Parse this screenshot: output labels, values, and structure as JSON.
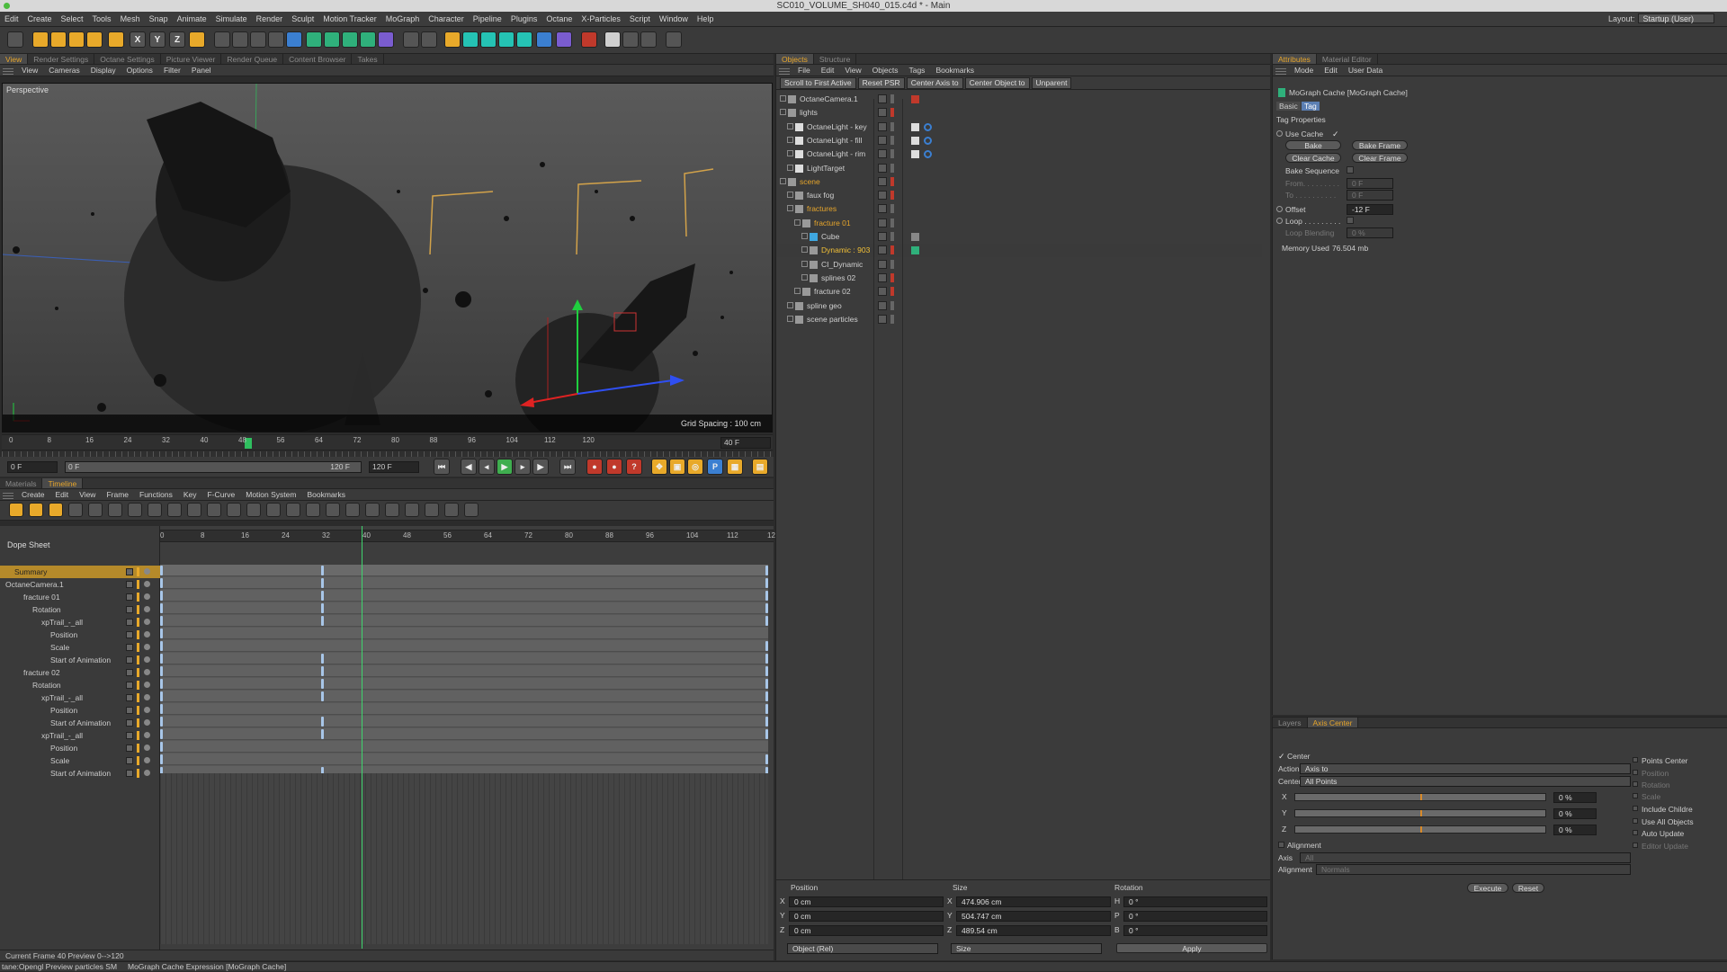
{
  "window": {
    "title": "SC010_VOLUME_SH040_015.c4d * - Main"
  },
  "menubar": [
    "Edit",
    "Create",
    "Select",
    "Tools",
    "Mesh",
    "Snap",
    "Animate",
    "Simulate",
    "Render",
    "Sculpt",
    "Motion Tracker",
    "MoGraph",
    "Character",
    "Pipeline",
    "Plugins",
    "Octane",
    "X-Particles",
    "Script",
    "Window",
    "Help"
  ],
  "layout": {
    "label": "Layout:",
    "value": "Startup (User)"
  },
  "viewport_tabs": [
    "View",
    "Render Settings",
    "Octane Settings",
    "Picture Viewer",
    "Render Queue",
    "Content Browser",
    "Takes"
  ],
  "viewport_menu": [
    "View",
    "Cameras",
    "Display",
    "Options",
    "Filter",
    "Panel"
  ],
  "viewport": {
    "label": "Perspective",
    "grid_spacing": "Grid Spacing : 100 cm"
  },
  "timeline_ruler": {
    "ticks": [
      "0",
      "8",
      "16",
      "24",
      "32",
      "40",
      "48",
      "56",
      "64",
      "72",
      "80",
      "88",
      "96",
      "104",
      "112",
      "120"
    ],
    "current": "40 F"
  },
  "playback": {
    "start": "0 F",
    "range_end": "120 F",
    "end": "120 F",
    "slider_start": "0 F"
  },
  "bottom_tabs": [
    "Materials",
    "Timeline"
  ],
  "timeline_menu": [
    "Create",
    "Edit",
    "View",
    "Frame",
    "Functions",
    "Key",
    "F-Curve",
    "Motion System",
    "Bookmarks"
  ],
  "dopesheet": {
    "title": "Dope Sheet",
    "ticks": [
      "0",
      "8",
      "16",
      "24",
      "32",
      "40",
      "48",
      "56",
      "64",
      "72",
      "80",
      "88",
      "96",
      "104",
      "112",
      "120"
    ],
    "rows": [
      {
        "label": "Summary",
        "indent": 1
      },
      {
        "label": "OctaneCamera.1",
        "indent": 0
      },
      {
        "label": "fracture 01",
        "indent": 2
      },
      {
        "label": "Rotation",
        "indent": 3
      },
      {
        "label": "xpTrail_-_all",
        "indent": 4
      },
      {
        "label": "Position",
        "indent": 5
      },
      {
        "label": "Scale",
        "indent": 5
      },
      {
        "label": "Start of Animation",
        "indent": 5
      },
      {
        "label": "fracture 02",
        "indent": 2
      },
      {
        "label": "Rotation",
        "indent": 3
      },
      {
        "label": "xpTrail_-_all",
        "indent": 4
      },
      {
        "label": "Position",
        "indent": 5
      },
      {
        "label": "Start of Animation",
        "indent": 5
      },
      {
        "label": "xpTrail_-_all",
        "indent": 4
      },
      {
        "label": "Position",
        "indent": 5
      },
      {
        "label": "Scale",
        "indent": 5
      },
      {
        "label": "Start of Animation",
        "indent": 5
      }
    ],
    "status": "Current Frame  40  Preview  0-->120"
  },
  "objects_tabs": [
    "Objects",
    "Structure"
  ],
  "objects_menu": [
    "File",
    "Edit",
    "View",
    "Objects",
    "Tags",
    "Bookmarks"
  ],
  "objects_buttons": [
    "Scroll to First Active",
    "Reset PSR",
    "Center Axis to",
    "Center Object to",
    "Unparent"
  ],
  "objects": [
    {
      "name": "OctaneCamera.1",
      "indent": 0,
      "color": "normal"
    },
    {
      "name": "lights",
      "indent": 0,
      "color": "normal"
    },
    {
      "name": "OctaneLight - key",
      "indent": 1,
      "color": "normal"
    },
    {
      "name": "OctaneLight - fill",
      "indent": 1,
      "color": "normal"
    },
    {
      "name": "OctaneLight - rim",
      "indent": 1,
      "color": "normal"
    },
    {
      "name": "LightTarget",
      "indent": 1,
      "color": "normal"
    },
    {
      "name": "scene",
      "indent": 0,
      "color": "orange"
    },
    {
      "name": "faux fog",
      "indent": 1,
      "color": "normal"
    },
    {
      "name": "fractures",
      "indent": 1,
      "color": "orange"
    },
    {
      "name": "fracture 01",
      "indent": 2,
      "color": "orange"
    },
    {
      "name": "Cube",
      "indent": 3,
      "color": "normal"
    },
    {
      "name": "Dynamic : 903",
      "indent": 3,
      "color": "selected"
    },
    {
      "name": "CI_Dynamic",
      "indent": 3,
      "color": "normal"
    },
    {
      "name": "splines 02",
      "indent": 3,
      "color": "normal"
    },
    {
      "name": "fracture 02",
      "indent": 2,
      "color": "normal"
    },
    {
      "name": "spline geo",
      "indent": 1,
      "color": "normal"
    },
    {
      "name": "scene particles",
      "indent": 1,
      "color": "normal"
    }
  ],
  "coords": {
    "headers": [
      "Position",
      "Size",
      "Rotation"
    ],
    "rows": [
      {
        "axis": "X",
        "pos": "0 cm",
        "saxis": "X",
        "size": "474.906 cm",
        "raxis": "H",
        "rot": "0 °"
      },
      {
        "axis": "Y",
        "pos": "0 cm",
        "saxis": "Y",
        "size": "504.747 cm",
        "raxis": "P",
        "rot": "0 °"
      },
      {
        "axis": "Z",
        "pos": "0 cm",
        "saxis": "Z",
        "size": "489.54 cm",
        "raxis": "B",
        "rot": "0 °"
      }
    ],
    "mode": "Object (Rel)",
    "size_mode": "Size",
    "apply": "Apply"
  },
  "attributes": {
    "tabs": [
      "Attributes",
      "Material Editor"
    ],
    "menu": [
      "Mode",
      "Edit",
      "User Data"
    ],
    "object": "MoGraph Cache [MoGraph Cache]",
    "subtabs": [
      "Basic",
      "Tag"
    ],
    "section": "Tag Properties",
    "use_cache": "Use Cache",
    "bake": "Bake",
    "bake_frame": "Bake Frame",
    "clear_cache": "Clear Cache",
    "clear_frame": "Clear Frame",
    "bake_sequence": "Bake Sequence",
    "from_label": "From. . . . . . . . .",
    "from_value": "0 F",
    "to_label": "To . . . . . . . . . .",
    "to_value": "0 F",
    "offset_label": "Offset",
    "offset_value": "-12 F",
    "loop_label": "Loop . . . . . . . . .",
    "loop_blending_label": "Loop Blending",
    "loop_blending_value": "0 %",
    "memory_label": "Memory Used",
    "memory_value": "76.504 mb"
  },
  "axis_center": {
    "tabs": [
      "Layers",
      "Axis Center"
    ],
    "center": "Center",
    "action_label": "Action",
    "action_value": "Axis to",
    "center_label": "Center",
    "center_value": "All Points",
    "sliders": [
      {
        "axis": "X",
        "value": "0 %",
        "level": 0.5
      },
      {
        "axis": "Y",
        "value": "0 %",
        "level": 0.5
      },
      {
        "axis": "Z",
        "value": "0 %",
        "level": 0.5
      }
    ],
    "alignment": "Alignment",
    "axis_label": "Axis",
    "axis_value": "All",
    "alignment_label": "Alignment",
    "alignment_value": "Normals",
    "right_options": [
      "Points Center",
      "Position",
      "Rotation",
      "Scale",
      "Include Childre",
      "Use All Objects",
      "Auto Update",
      "Editor Update"
    ],
    "execute": "Execute",
    "reset": "Reset"
  },
  "statusbar": {
    "left": "tane:Opengl Preview particles SM",
    "right": "MoGraph Cache Expression [MoGraph Cache]"
  }
}
